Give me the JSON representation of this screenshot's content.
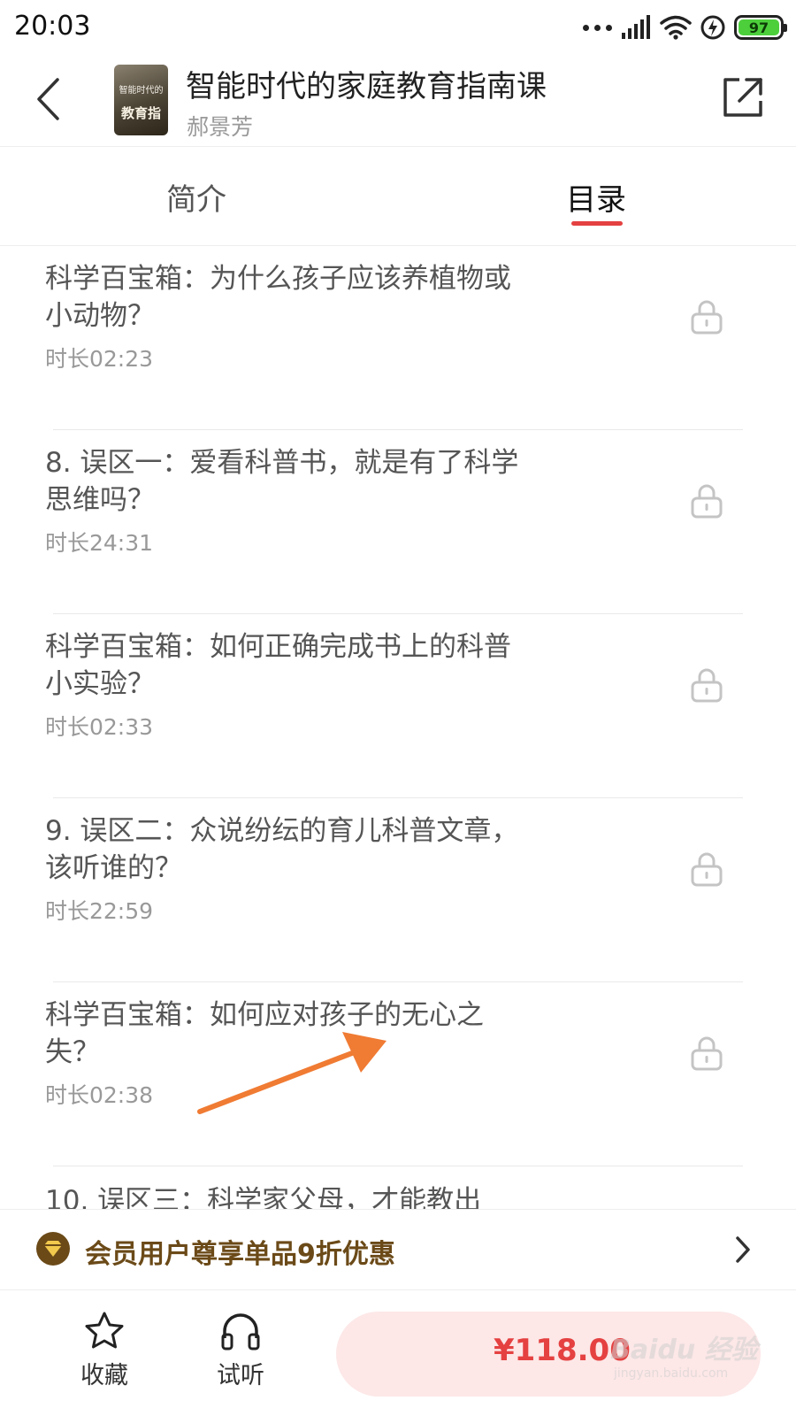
{
  "status_bar": {
    "time": "20:03",
    "battery": "97",
    "icons": [
      "more-dots-icon",
      "signal-icon",
      "wifi-icon",
      "charging-icon",
      "battery-icon"
    ],
    "battery_color": "#4ccf3b"
  },
  "header": {
    "title": "智能时代的家庭教育指南课",
    "author": "郝景芳",
    "cover_text_small": "智能时代的",
    "cover_text_large": "教育指"
  },
  "tabs": [
    {
      "label": "简介",
      "active": false
    },
    {
      "label": "目录",
      "active": true
    }
  ],
  "accent_color": "#e44141",
  "list": {
    "items": [
      {
        "title": "科学百宝箱：为什么孩子应该养植物或小动物？",
        "duration": "时长02:23",
        "locked": true
      },
      {
        "title": "8. 误区一：爱看科普书，就是有了科学思维吗？",
        "duration": "时长24:31",
        "locked": true
      },
      {
        "title": "科学百宝箱：如何正确完成书上的科普小实验？",
        "duration": "时长02:33",
        "locked": true
      },
      {
        "title": "9. 误区二：众说纷纭的育儿科普文章，该听谁的？",
        "duration": "时长22:59",
        "locked": true
      },
      {
        "title": "科学百宝箱：如何应对孩子的无心之失？",
        "duration": "时长02:38",
        "locked": true
      },
      {
        "title": "10. 误区三：科学家父母，才能教出",
        "duration": "",
        "locked": true
      }
    ]
  },
  "promo": {
    "text": "会员用户尊享单品9折优惠",
    "color": "#6b4a18"
  },
  "bottom_bar": {
    "favorite_label": "收藏",
    "listen_label": "试听",
    "price": "¥118.00",
    "price_color": "#e54141"
  },
  "watermark": {
    "main": "Baidu 经验",
    "sub": "jingyan.baidu.com"
  }
}
